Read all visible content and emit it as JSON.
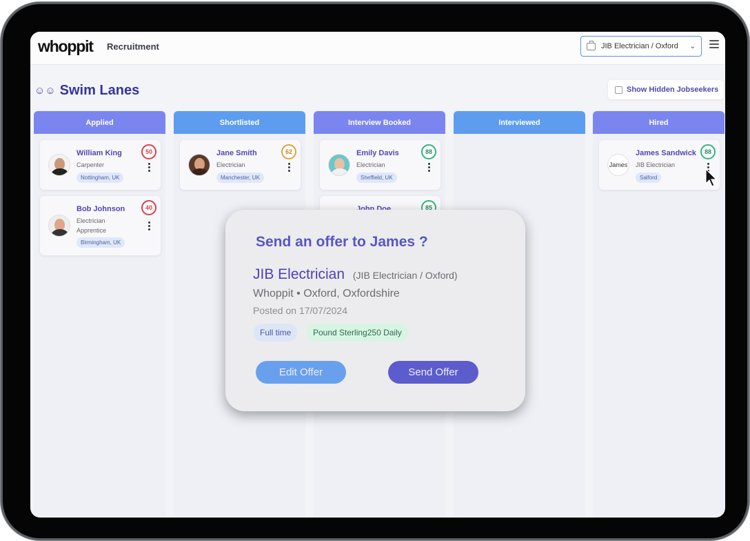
{
  "header": {
    "logo": "whoppit",
    "app_title": "Recruitment",
    "job_selector": {
      "value": "JIB Electrician / Oxford",
      "icon": "briefcase-icon"
    },
    "menu_icon": "hamburger-icon"
  },
  "page": {
    "title": "Swim Lanes",
    "title_icon": "users-icon",
    "show_hidden_label": "Show Hidden Jobseekers",
    "show_hidden_checked": false
  },
  "lanes": [
    {
      "title": "Applied",
      "color": "#7b85f0",
      "cards": [
        {
          "name": "William King",
          "role": "Carpenter",
          "location": "Nottingham, UK",
          "score": "50",
          "score_color": "#d9404a"
        },
        {
          "name": "Bob Johnson",
          "role": "Electrician Apprentice",
          "location": "Birmingham, UK",
          "score": "40",
          "score_color": "#d9404a"
        }
      ]
    },
    {
      "title": "Shortlisted",
      "color": "#5e9cf0",
      "cards": [
        {
          "name": "Jane Smith",
          "role": "Electrician",
          "location": "Manchester, UK",
          "score": "62",
          "score_color": "#e0a43a"
        }
      ]
    },
    {
      "title": "Interview Booked",
      "color": "#7b85f0",
      "cards": [
        {
          "name": "Emily Davis",
          "role": "Electrician",
          "location": "Sheffield, UK",
          "score": "88",
          "score_color": "#2fb57c"
        },
        {
          "name": "John Doe",
          "role": "",
          "location": "",
          "score": "85",
          "score_color": "#2fb57c"
        }
      ]
    },
    {
      "title": "Interviewed",
      "color": "#5e9cf0",
      "cards": []
    },
    {
      "title": "Hired",
      "color": "#7b85f0",
      "cards": [
        {
          "name": "James Sandwick",
          "role": "JIB Electrician",
          "location": "Salford",
          "score": "88",
          "score_color": "#2fb57c",
          "avatar_alt": "James"
        }
      ]
    }
  ],
  "modal": {
    "title": "Send an offer to James ?",
    "job_title": "JIB Electrician",
    "job_subtitle": "(JIB Electrician / Oxford)",
    "company_location": "Whoppit • Oxford, Oxfordshire",
    "posted": "Posted on 17/07/2024",
    "tags": [
      "Full time",
      "Pound Sterling250 Daily"
    ],
    "edit_label": "Edit Offer",
    "send_label": "Send Offer"
  }
}
